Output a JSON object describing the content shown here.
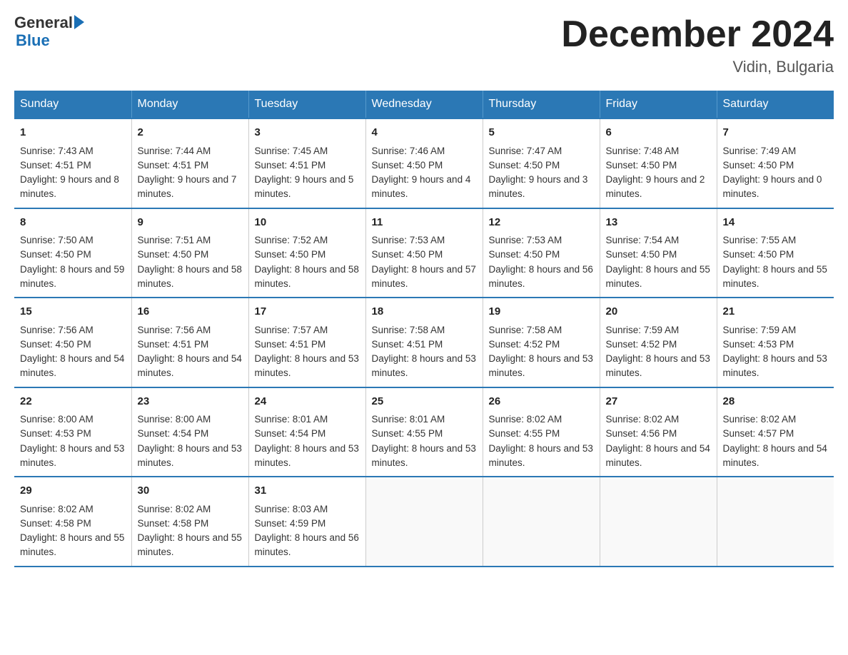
{
  "header": {
    "logo_general": "General",
    "logo_blue": "Blue",
    "title": "December 2024",
    "subtitle": "Vidin, Bulgaria"
  },
  "weekdays": [
    "Sunday",
    "Monday",
    "Tuesday",
    "Wednesday",
    "Thursday",
    "Friday",
    "Saturday"
  ],
  "weeks": [
    [
      {
        "day": "1",
        "sunrise": "7:43 AM",
        "sunset": "4:51 PM",
        "daylight": "9 hours and 8 minutes."
      },
      {
        "day": "2",
        "sunrise": "7:44 AM",
        "sunset": "4:51 PM",
        "daylight": "9 hours and 7 minutes."
      },
      {
        "day": "3",
        "sunrise": "7:45 AM",
        "sunset": "4:51 PM",
        "daylight": "9 hours and 5 minutes."
      },
      {
        "day": "4",
        "sunrise": "7:46 AM",
        "sunset": "4:50 PM",
        "daylight": "9 hours and 4 minutes."
      },
      {
        "day": "5",
        "sunrise": "7:47 AM",
        "sunset": "4:50 PM",
        "daylight": "9 hours and 3 minutes."
      },
      {
        "day": "6",
        "sunrise": "7:48 AM",
        "sunset": "4:50 PM",
        "daylight": "9 hours and 2 minutes."
      },
      {
        "day": "7",
        "sunrise": "7:49 AM",
        "sunset": "4:50 PM",
        "daylight": "9 hours and 0 minutes."
      }
    ],
    [
      {
        "day": "8",
        "sunrise": "7:50 AM",
        "sunset": "4:50 PM",
        "daylight": "8 hours and 59 minutes."
      },
      {
        "day": "9",
        "sunrise": "7:51 AM",
        "sunset": "4:50 PM",
        "daylight": "8 hours and 58 minutes."
      },
      {
        "day": "10",
        "sunrise": "7:52 AM",
        "sunset": "4:50 PM",
        "daylight": "8 hours and 58 minutes."
      },
      {
        "day": "11",
        "sunrise": "7:53 AM",
        "sunset": "4:50 PM",
        "daylight": "8 hours and 57 minutes."
      },
      {
        "day": "12",
        "sunrise": "7:53 AM",
        "sunset": "4:50 PM",
        "daylight": "8 hours and 56 minutes."
      },
      {
        "day": "13",
        "sunrise": "7:54 AM",
        "sunset": "4:50 PM",
        "daylight": "8 hours and 55 minutes."
      },
      {
        "day": "14",
        "sunrise": "7:55 AM",
        "sunset": "4:50 PM",
        "daylight": "8 hours and 55 minutes."
      }
    ],
    [
      {
        "day": "15",
        "sunrise": "7:56 AM",
        "sunset": "4:50 PM",
        "daylight": "8 hours and 54 minutes."
      },
      {
        "day": "16",
        "sunrise": "7:56 AM",
        "sunset": "4:51 PM",
        "daylight": "8 hours and 54 minutes."
      },
      {
        "day": "17",
        "sunrise": "7:57 AM",
        "sunset": "4:51 PM",
        "daylight": "8 hours and 53 minutes."
      },
      {
        "day": "18",
        "sunrise": "7:58 AM",
        "sunset": "4:51 PM",
        "daylight": "8 hours and 53 minutes."
      },
      {
        "day": "19",
        "sunrise": "7:58 AM",
        "sunset": "4:52 PM",
        "daylight": "8 hours and 53 minutes."
      },
      {
        "day": "20",
        "sunrise": "7:59 AM",
        "sunset": "4:52 PM",
        "daylight": "8 hours and 53 minutes."
      },
      {
        "day": "21",
        "sunrise": "7:59 AM",
        "sunset": "4:53 PM",
        "daylight": "8 hours and 53 minutes."
      }
    ],
    [
      {
        "day": "22",
        "sunrise": "8:00 AM",
        "sunset": "4:53 PM",
        "daylight": "8 hours and 53 minutes."
      },
      {
        "day": "23",
        "sunrise": "8:00 AM",
        "sunset": "4:54 PM",
        "daylight": "8 hours and 53 minutes."
      },
      {
        "day": "24",
        "sunrise": "8:01 AM",
        "sunset": "4:54 PM",
        "daylight": "8 hours and 53 minutes."
      },
      {
        "day": "25",
        "sunrise": "8:01 AM",
        "sunset": "4:55 PM",
        "daylight": "8 hours and 53 minutes."
      },
      {
        "day": "26",
        "sunrise": "8:02 AM",
        "sunset": "4:55 PM",
        "daylight": "8 hours and 53 minutes."
      },
      {
        "day": "27",
        "sunrise": "8:02 AM",
        "sunset": "4:56 PM",
        "daylight": "8 hours and 54 minutes."
      },
      {
        "day": "28",
        "sunrise": "8:02 AM",
        "sunset": "4:57 PM",
        "daylight": "8 hours and 54 minutes."
      }
    ],
    [
      {
        "day": "29",
        "sunrise": "8:02 AM",
        "sunset": "4:58 PM",
        "daylight": "8 hours and 55 minutes."
      },
      {
        "day": "30",
        "sunrise": "8:02 AM",
        "sunset": "4:58 PM",
        "daylight": "8 hours and 55 minutes."
      },
      {
        "day": "31",
        "sunrise": "8:03 AM",
        "sunset": "4:59 PM",
        "daylight": "8 hours and 56 minutes."
      },
      null,
      null,
      null,
      null
    ]
  ],
  "labels": {
    "sunrise": "Sunrise:",
    "sunset": "Sunset:",
    "daylight": "Daylight:"
  }
}
